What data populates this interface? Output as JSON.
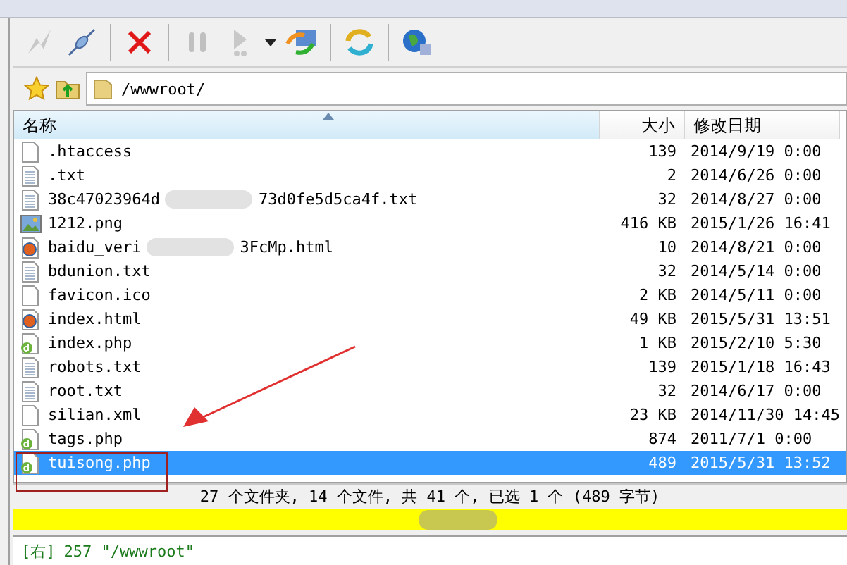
{
  "address": {
    "path": "/wwwroot/"
  },
  "table": {
    "columns": [
      {
        "label": "名称",
        "sorted": true
      },
      {
        "label": "大小",
        "sorted": false
      },
      {
        "label": "修改日期",
        "sorted": false
      }
    ],
    "rows": [
      {
        "kind": "file",
        "name": ".htaccess",
        "size": "139",
        "date": "2014/9/19 0:00",
        "selected": false
      },
      {
        "kind": "text",
        "name": ".txt",
        "size": "2",
        "date": "2014/6/26 0:00",
        "selected": false
      },
      {
        "kind": "text",
        "name": "38c47023964d",
        "name_after_blur": "73d0fe5d5ca4f.txt",
        "size": "32",
        "date": "2014/8/27 0:00",
        "selected": false
      },
      {
        "kind": "image",
        "name": "1212.png",
        "size": "416 KB",
        "date": "2015/1/26 16:41",
        "selected": false
      },
      {
        "kind": "html",
        "name": "baidu_veri",
        "name_after_blur": "3FcMp.html",
        "size": "10",
        "date": "2014/8/21 0:00",
        "selected": false
      },
      {
        "kind": "text",
        "name": "bdunion.txt",
        "size": "32",
        "date": "2014/5/14 0:00",
        "selected": false
      },
      {
        "kind": "file",
        "name": "favicon.ico",
        "size": "2 KB",
        "date": "2014/5/11 0:00",
        "selected": false
      },
      {
        "kind": "html",
        "name": "index.html",
        "size": "49 KB",
        "date": "2015/5/31 13:51",
        "selected": false
      },
      {
        "kind": "php",
        "name": "index.php",
        "size": "1 KB",
        "date": "2015/2/10 5:30",
        "selected": false
      },
      {
        "kind": "text",
        "name": "robots.txt",
        "size": "139",
        "date": "2015/1/18 16:43",
        "selected": false
      },
      {
        "kind": "text",
        "name": "root.txt",
        "size": "32",
        "date": "2014/6/17 0:00",
        "selected": false
      },
      {
        "kind": "file",
        "name": "silian.xml",
        "size": "23 KB",
        "date": "2014/11/30 14:45",
        "selected": false
      },
      {
        "kind": "php",
        "name": "tags.php",
        "size": "874",
        "date": "2011/7/1 0:00",
        "selected": false
      },
      {
        "kind": "php",
        "name": "tuisong.php",
        "size": "489",
        "date": "2015/5/31 13:52",
        "selected": true
      }
    ]
  },
  "status_bar": {
    "text": "27 个文件夹, 14 个文件, 共 41 个, 已选 1 个 (489 字节)"
  },
  "log": {
    "source": "[右]",
    "message": "257 \"/wwwroot\""
  }
}
